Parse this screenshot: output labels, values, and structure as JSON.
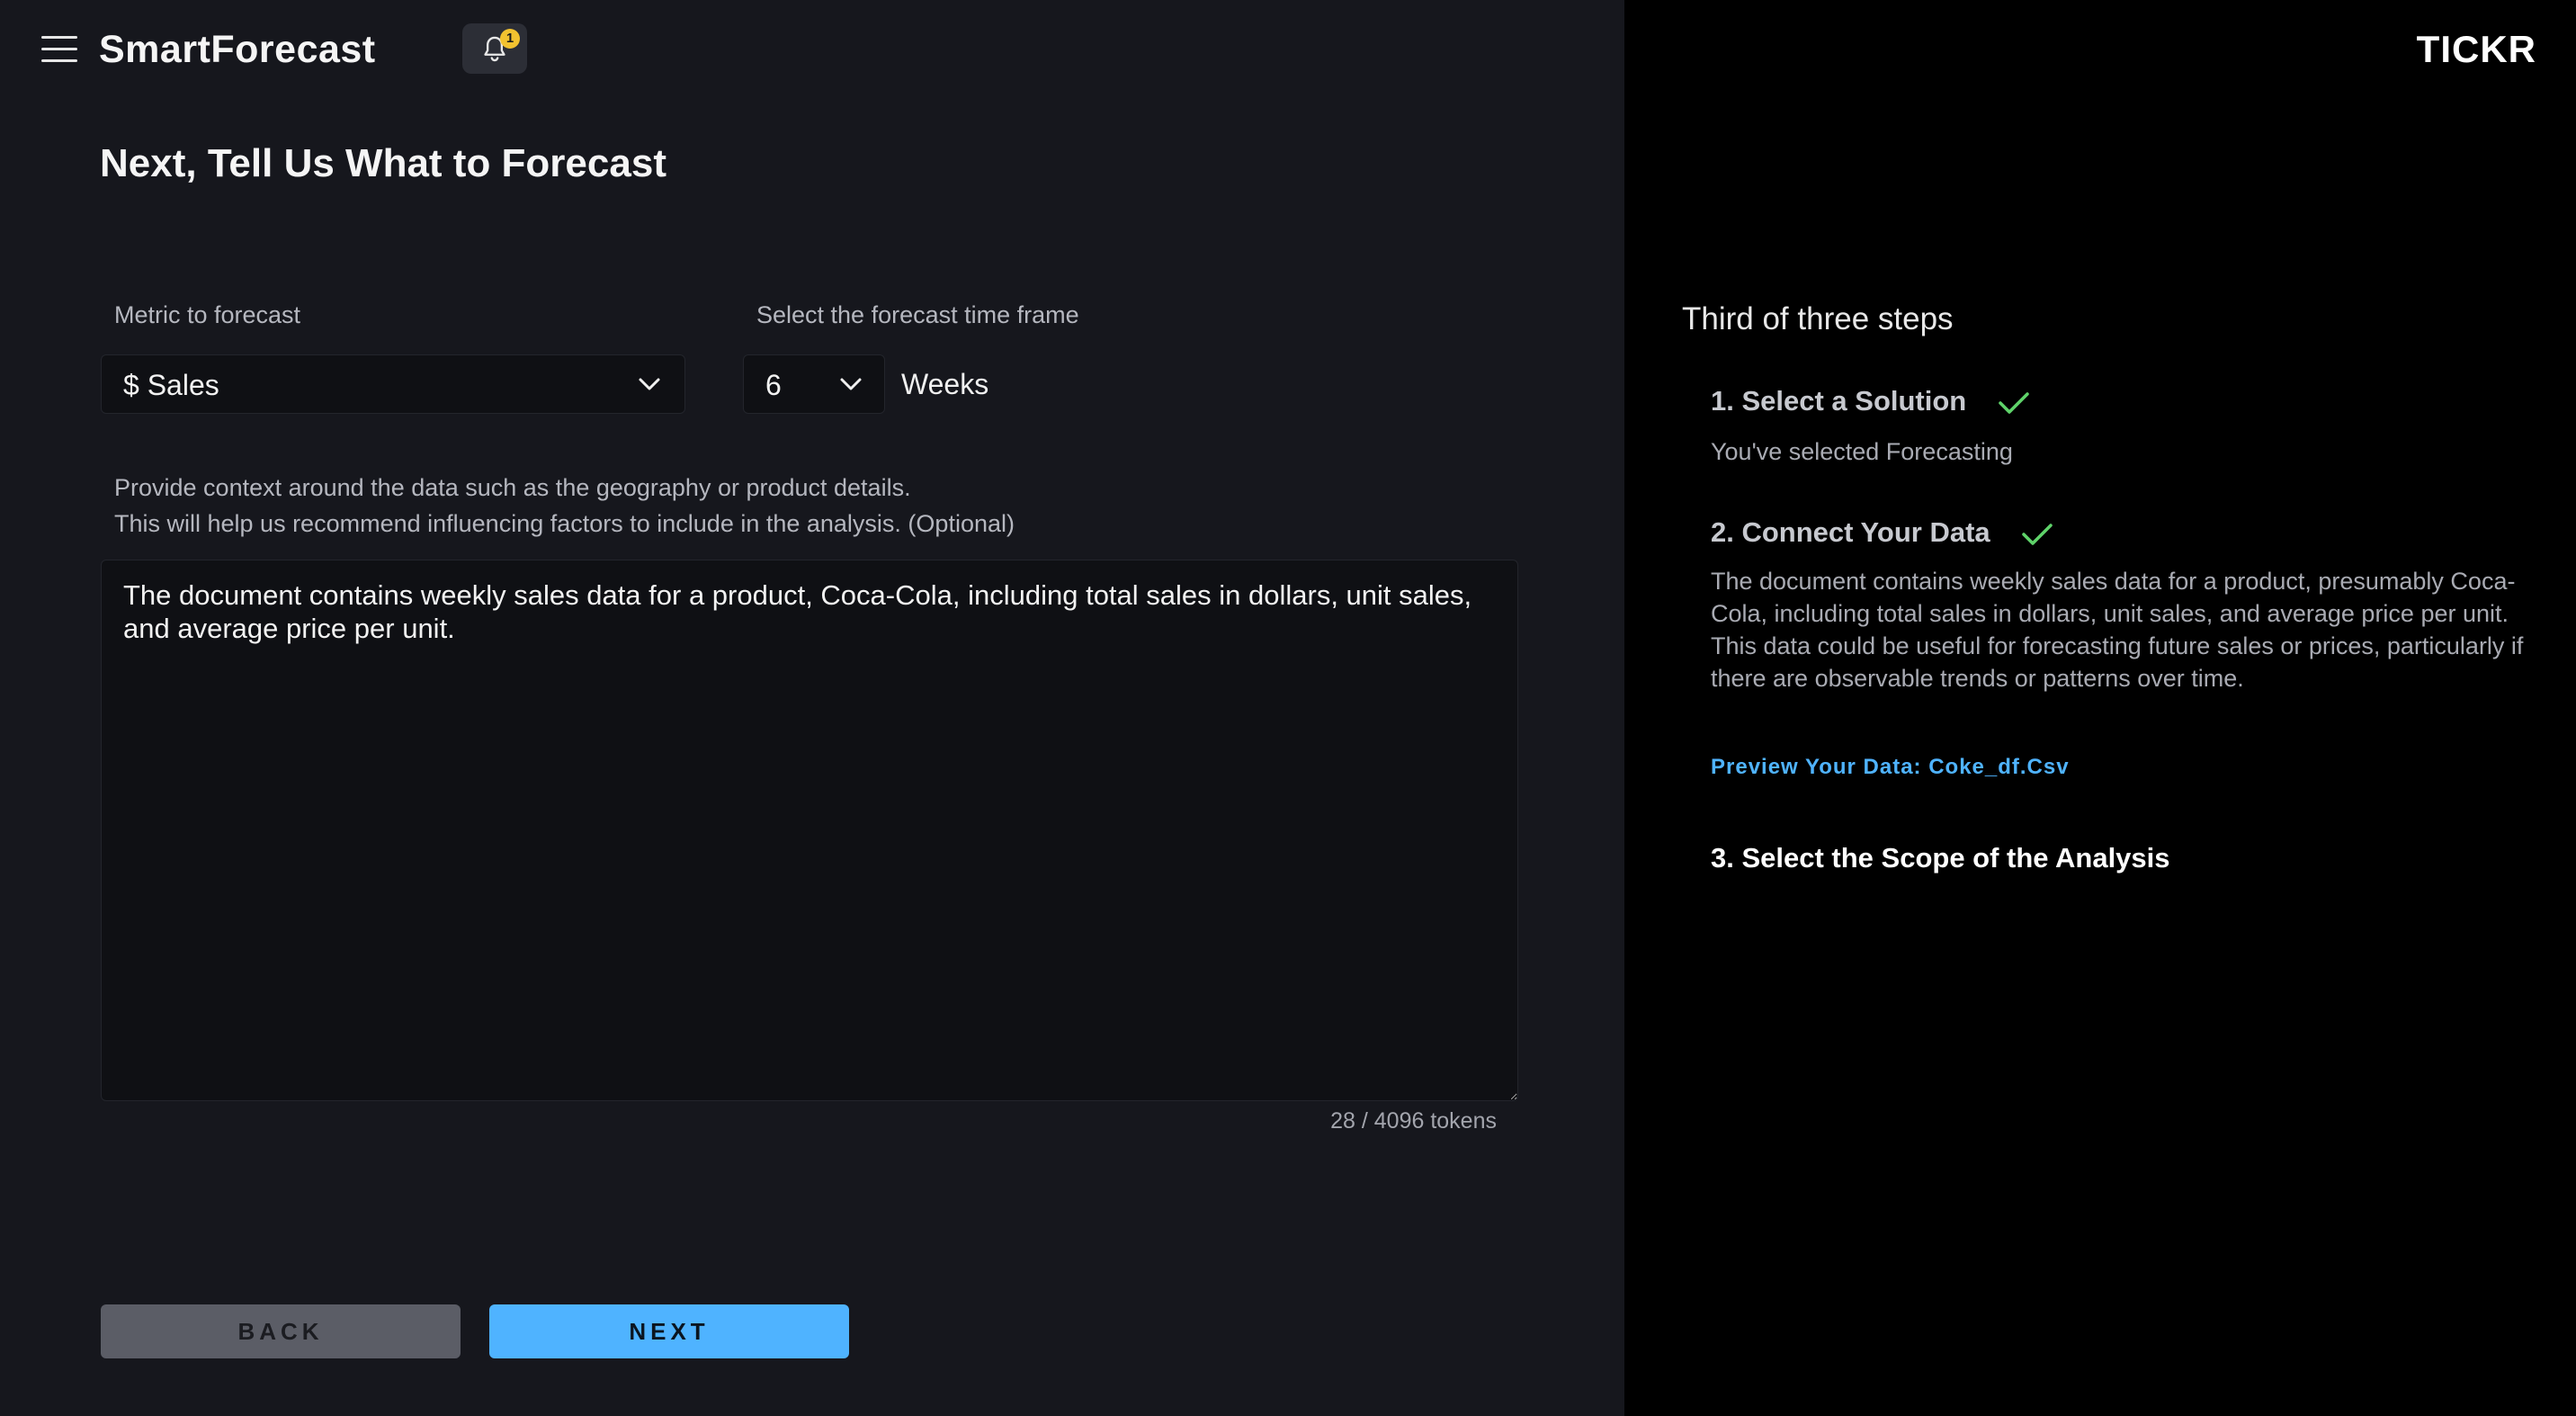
{
  "header": {
    "app_title": "SmartForecast",
    "notification_count": "1",
    "menu_icon": "hamburger-menu-icon",
    "bell_icon": "bell-icon"
  },
  "main": {
    "heading": "Next, Tell Us What to Forecast",
    "metric": {
      "label": "Metric to forecast",
      "value": "$ Sales"
    },
    "timeframe": {
      "label": "Select the forecast time frame",
      "value": "6",
      "unit": "Weeks"
    },
    "context": {
      "help_line1": "Provide context around the data such as the geography or product details.",
      "help_line2": "This will help us recommend influencing factors to include in the analysis. (Optional)",
      "value": "The document contains weekly sales data for a product, Coca-Cola, including total sales in dollars, unit sales, and average price per unit.",
      "token_count": "28 / 4096 tokens"
    },
    "buttons": {
      "back": "BACK",
      "next": "NEXT"
    }
  },
  "side": {
    "brand": "TICKR",
    "steps_heading": "Third of three steps",
    "steps": [
      {
        "title": "1. Select a Solution",
        "description": "You've selected Forecasting",
        "complete": true
      },
      {
        "title": "2. Connect Your Data",
        "description": "The document contains weekly sales data for a product, presumably Coca-Cola, including total sales in dollars, unit sales, and average price per unit. This data could be useful for forecasting future sales or prices, particularly if there are observable trends or patterns over time.",
        "complete": true
      },
      {
        "title": "3. Select the Scope of the Analysis",
        "complete": false
      }
    ],
    "preview_link": "Preview Your Data: Coke_df.Csv"
  },
  "colors": {
    "accent": "#4fb3ff",
    "check": "#5fd36a",
    "badge": "#f2c230",
    "main_bg": "#16171d",
    "side_bg": "#000000"
  }
}
